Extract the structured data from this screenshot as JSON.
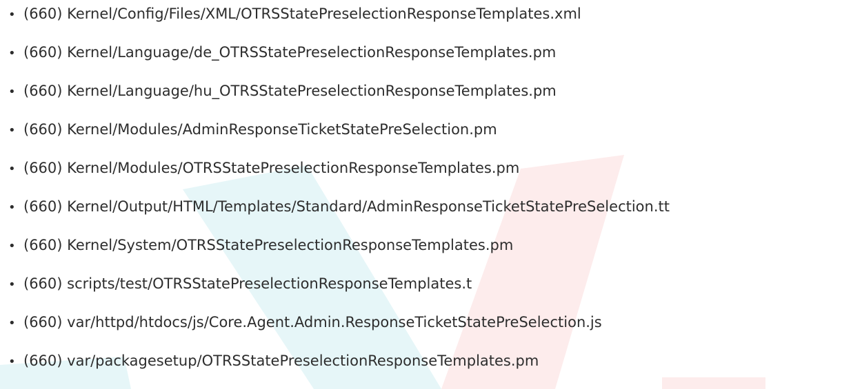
{
  "file_list": {
    "items": [
      {
        "bullet": "•",
        "text": "(660) Kernel/Config/Files/XML/OTRSStatePreselectionResponseTemplates.xml"
      },
      {
        "bullet": "•",
        "text": "(660) Kernel/Language/de_OTRSStatePreselectionResponseTemplates.pm"
      },
      {
        "bullet": "•",
        "text": "(660) Kernel/Language/hu_OTRSStatePreselectionResponseTemplates.pm"
      },
      {
        "bullet": "•",
        "text": "(660) Kernel/Modules/AdminResponseTicketStatePreSelection.pm"
      },
      {
        "bullet": "•",
        "text": "(660) Kernel/Modules/OTRSStatePreselectionResponseTemplates.pm"
      },
      {
        "bullet": "•",
        "text": "(660) Kernel/Output/HTML/Templates/Standard/AdminResponseTicketStatePreSelection.tt"
      },
      {
        "bullet": "•",
        "text": "(660) Kernel/System/OTRSStatePreselectionResponseTemplates.pm"
      },
      {
        "bullet": "•",
        "text": "(660) scripts/test/OTRSStatePreselectionResponseTemplates.t"
      },
      {
        "bullet": "•",
        "text": "(660) var/httpd/htdocs/js/Core.Agent.Admin.ResponseTicketStatePreSelection.js"
      },
      {
        "bullet": "•",
        "text": "(660) var/packagesetup/OTRSStatePreselectionResponseTemplates.pm"
      }
    ]
  },
  "watermark": {
    "logo_name": "otrs-v-logo-icon",
    "colors": {
      "left_stroke": "#e6f6f8",
      "right_stroke": "#fdecec",
      "text": "#2d2d2d"
    }
  }
}
